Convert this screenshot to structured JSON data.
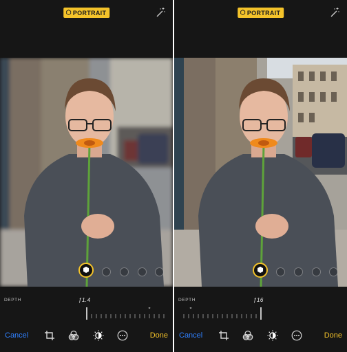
{
  "panels": [
    {
      "badge_label": "PORTRAIT",
      "depth_label": "DEPTH",
      "depth_value": "ƒ1.4",
      "cancel_label": "Cancel",
      "done_label": "Done",
      "depth_level": 0.0
    },
    {
      "badge_label": "PORTRAIT",
      "depth_label": "DEPTH",
      "depth_value": "ƒ16",
      "cancel_label": "Cancel",
      "done_label": "Done",
      "depth_level": 1.0
    }
  ],
  "icons": {
    "badge": "cube-icon",
    "top_right": "magic-wand-icon",
    "lighting_active": "hexagon-lighting-icon",
    "toolbar": [
      "crop-rotate-icon",
      "filters-icon",
      "adjust-dial-icon",
      "more-icon"
    ]
  },
  "colors": {
    "accent_yellow": "#f4c32a",
    "cancel_blue": "#2f80ff",
    "chrome_dark": "#161616"
  }
}
